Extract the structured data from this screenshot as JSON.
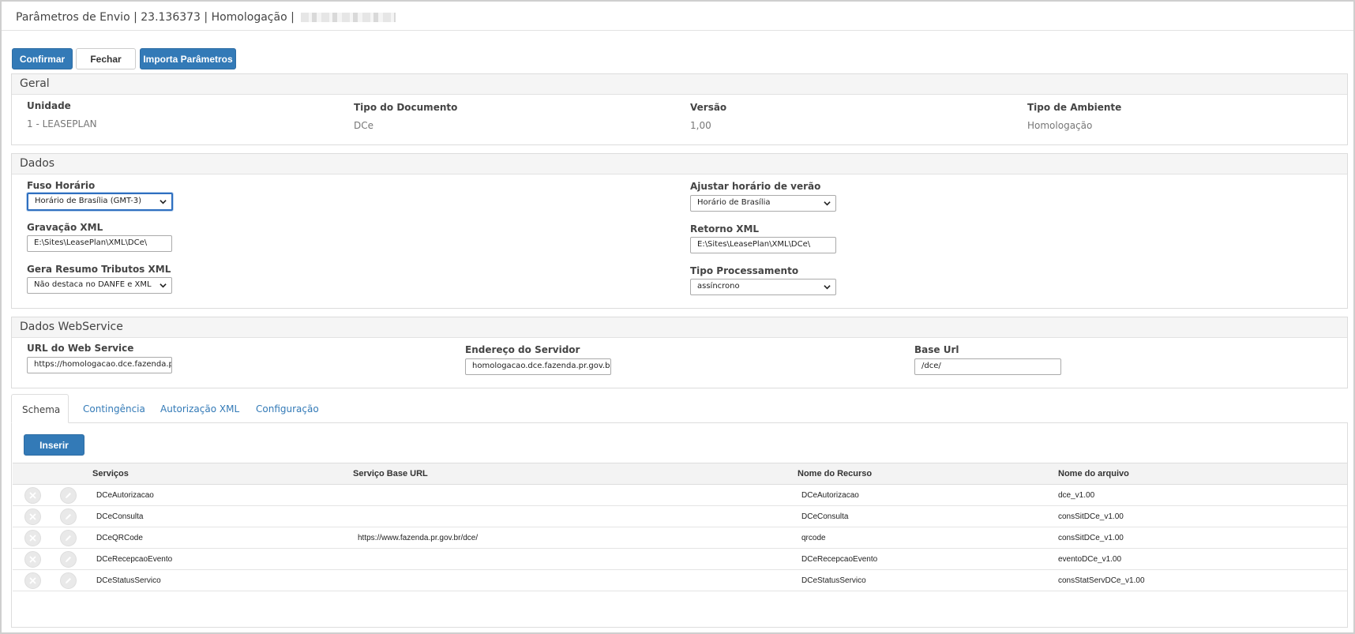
{
  "header": {
    "title": "Parâmetros de Envio | 23.136373 | Homologação |"
  },
  "toolbar": {
    "confirm": "Confirmar",
    "close": "Fechar",
    "import": "Importa Parâmetros"
  },
  "geral": {
    "title": "Geral",
    "unidade": {
      "label": "Unidade",
      "value": "1 - LEASEPLAN"
    },
    "tipo_documento": {
      "label": "Tipo do Documento",
      "value": "DCe"
    },
    "versao": {
      "label": "Versão",
      "value": "1,00"
    },
    "tipo_ambiente": {
      "label": "Tipo de Ambiente",
      "value": "Homologação"
    }
  },
  "dados": {
    "title": "Dados",
    "fuso": {
      "label": "Fuso Horário",
      "value": "Horário de Brasília (GMT-3)"
    },
    "horario_verao": {
      "label": "Ajustar horário de verão",
      "value": "Horário de Brasília"
    },
    "gravacao_xml": {
      "label": "Gravação XML",
      "value": "E:\\Sites\\LeasePlan\\XML\\DCe\\"
    },
    "retorno_xml": {
      "label": "Retorno XML",
      "value": "E:\\Sites\\LeasePlan\\XML\\DCe\\"
    },
    "gera_resumo": {
      "label": "Gera Resumo Tributos XML",
      "value": "Não destaca no DANFE e XML"
    },
    "tipo_processamento": {
      "label": "Tipo Processamento",
      "value": "assíncrono"
    }
  },
  "webservice": {
    "title": "Dados WebService",
    "url": {
      "label": "URL do Web Service",
      "value": "https://homologacao.dce.fazenda.pr.gov.br"
    },
    "endereco": {
      "label": "Endereço do Servidor",
      "value": "homologacao.dce.fazenda.pr.gov.br"
    },
    "base_url": {
      "label": "Base Url",
      "value": "/dce/"
    }
  },
  "tabs": [
    "Schema",
    "Contingência",
    "Autorização XML",
    "Configuração"
  ],
  "schema": {
    "insert": "Inserir",
    "columns": [
      "Serviços",
      "Serviço Base URL",
      "Nome do Recurso",
      "Nome do arquivo"
    ],
    "rows": [
      [
        "DCeAutorizacao",
        "",
        "DCeAutorizacao",
        "dce_v1.00"
      ],
      [
        "DCeConsulta",
        "",
        "DCeConsulta",
        "consSitDCe_v1.00"
      ],
      [
        "DCeQRCode",
        "https://www.fazenda.pr.gov.br/dce/",
        "qrcode",
        "consSitDCe_v1.00"
      ],
      [
        "DCeRecepcaoEvento",
        "",
        "DCeRecepcaoEvento",
        "eventoDCe_v1.00"
      ],
      [
        "DCeStatusServico",
        "",
        "DCeStatusServico",
        "consStatServDCe_v1.00"
      ]
    ]
  },
  "icons": {
    "delete": "close-icon",
    "edit": "pencil-icon",
    "select": "chevron-down-icon"
  }
}
